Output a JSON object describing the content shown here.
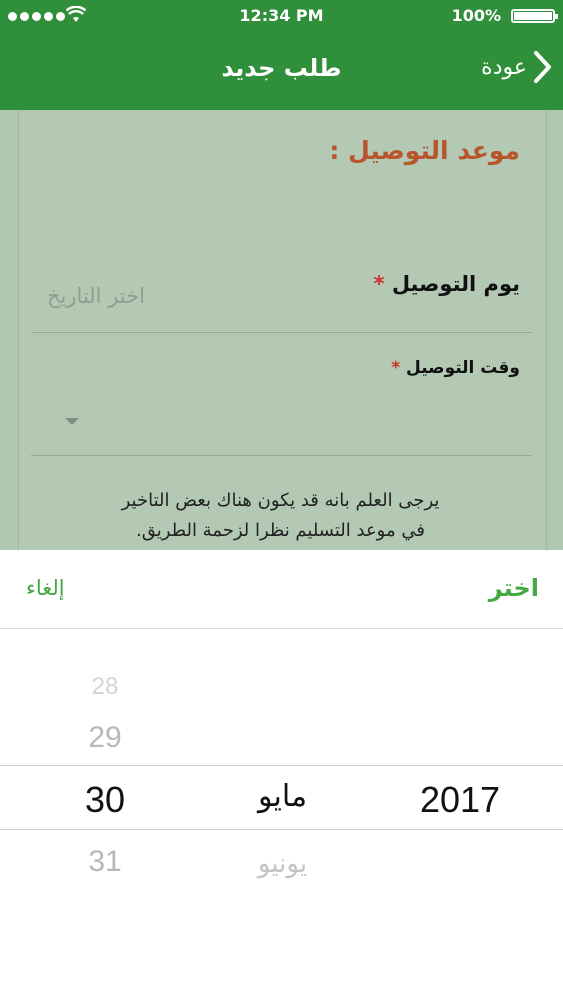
{
  "status_bar": {
    "time": "12:34 PM",
    "battery": "100%"
  },
  "nav": {
    "title": "طلب جديد",
    "back_label": "عودة"
  },
  "form": {
    "section_title": "موعد التوصيل :",
    "delivery_date": {
      "label": "يوم التوصيل",
      "required_mark": "*",
      "placeholder": "اختر التاريخ"
    },
    "delivery_time": {
      "label": "وقت التوصيل",
      "required_mark": "*"
    },
    "notice_line1": "يرجى العلم بانه قد يكون هناك بعض التاخير",
    "notice_line2": "في موعد التسليم نظرا لزحمة الطريق."
  },
  "picker": {
    "select_label": "اختر",
    "cancel_label": "إلغاء",
    "days": [
      "28",
      "29",
      "30",
      "31"
    ],
    "selected_day": "30",
    "months": [
      "مايو",
      "يونيو"
    ],
    "selected_month": "مايو",
    "selected_year": "2017"
  },
  "colors": {
    "header_green": "#2f8f3b",
    "accent_green": "#45a845",
    "section_title_orange": "#b8552c",
    "required_red": "#d0302a",
    "overlay_form": "#b3c9b4"
  }
}
